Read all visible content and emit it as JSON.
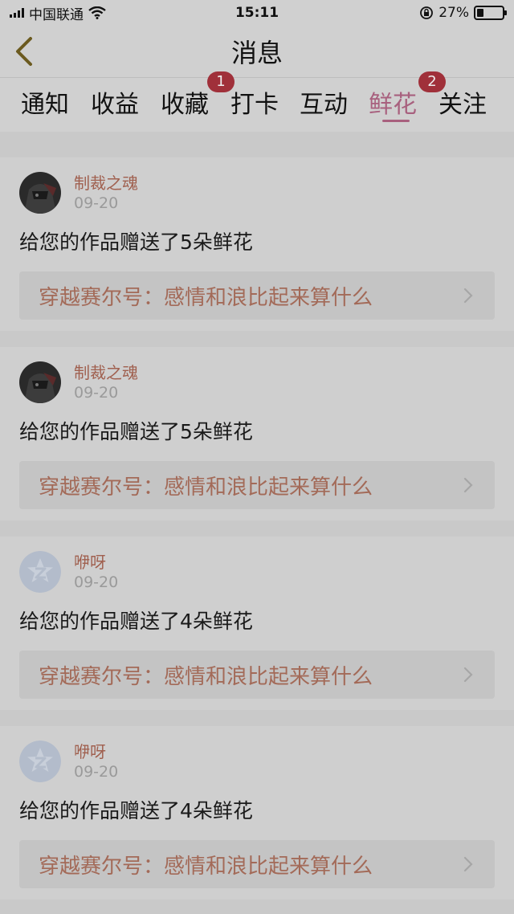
{
  "status_bar": {
    "carrier": "中国联通",
    "time": "15:11",
    "battery": "27%",
    "battery_level": 0.27
  },
  "header": {
    "title": "消息"
  },
  "tabs": [
    {
      "label": "通知"
    },
    {
      "label": "收益"
    },
    {
      "label": "收藏",
      "badge": "1"
    },
    {
      "label": "打卡"
    },
    {
      "label": "互动"
    },
    {
      "label": "鲜花",
      "badge": "2",
      "active": true
    },
    {
      "label": "关注"
    }
  ],
  "messages": [
    {
      "user": "制裁之魂",
      "date": "09-20",
      "text": "给您的作品赠送了5朵鲜花",
      "work": "穿越赛尔号：感情和浪比起来算什么",
      "avatar": "dark-photo"
    },
    {
      "user": "制裁之魂",
      "date": "09-20",
      "text": "给您的作品赠送了5朵鲜花",
      "work": "穿越赛尔号：感情和浪比起来算什么",
      "avatar": "dark-photo"
    },
    {
      "user": "咿呀",
      "date": "09-20",
      "text": "给您的作品赠送了4朵鲜花",
      "work": "穿越赛尔号：感情和浪比起来算什么",
      "avatar": "default-avatar"
    },
    {
      "user": "咿呀",
      "date": "09-20",
      "text": "给您的作品赠送了4朵鲜花",
      "work": "穿越赛尔号：感情和浪比起来算什么",
      "avatar": "default-avatar"
    }
  ],
  "colors": {
    "accent": "#a8607e",
    "badge": "#a0303a",
    "username": "#a0604f",
    "work_title": "#a36a58"
  }
}
